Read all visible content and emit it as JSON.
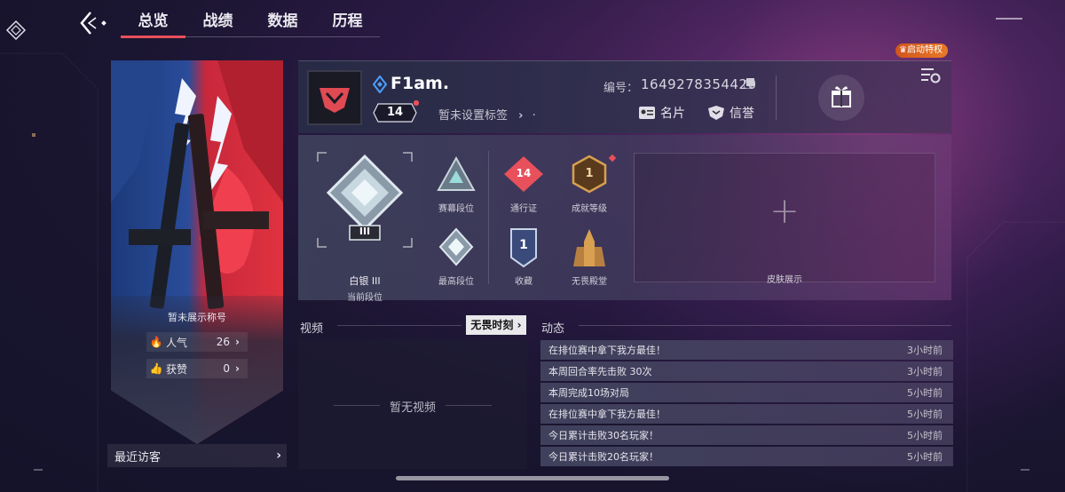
{
  "nav": {
    "tabs": [
      {
        "label": "总览",
        "active": true
      },
      {
        "label": "战绩",
        "active": false
      },
      {
        "label": "数据",
        "active": false
      },
      {
        "label": "历程",
        "active": false
      }
    ]
  },
  "privilege_badge": "启动特权",
  "profile": {
    "name": "F1am.",
    "level": "14",
    "tag_placeholder": "暂未设置标签",
    "uid_label": "编号：",
    "uid_value": "1649278354420",
    "card_label": "名片",
    "credit_label": "信誉"
  },
  "banner": {
    "title": "暂未展示称号",
    "popularity_label": "人气",
    "popularity_value": "26",
    "likes_label": "获赞",
    "likes_value": "0"
  },
  "recent_visitors": "最近访客",
  "ranks": {
    "current_rank_name": "白银 III",
    "current_rank_label": "当前段位",
    "current_rank_numeral": "III",
    "season_rank_label": "赛幕段位",
    "highest_rank_label": "最高段位",
    "battle_pass_label": "通行证",
    "battle_pass_value": "14",
    "collection_label": "收藏",
    "collection_value": "1",
    "achievement_label": "成就等级",
    "achievement_value": "1",
    "hall_label": "无畏殿堂",
    "skin_label": "皮肤展示",
    "skin_plus": "+"
  },
  "video": {
    "title": "视频",
    "moments_button": "无畏时刻",
    "empty_text": "暂无视频"
  },
  "feed": {
    "title": "动态",
    "items": [
      {
        "text": "在排位赛中拿下我方最佳！",
        "time": "3小时前"
      },
      {
        "text": "本周回合率先击败 30次",
        "time": "3小时前"
      },
      {
        "text": "本周完成10场对局",
        "time": "5小时前"
      },
      {
        "text": "在排位赛中拿下我方最佳！",
        "time": "5小时前"
      },
      {
        "text": "今日累计击败30名玩家！",
        "time": "5小时前"
      },
      {
        "text": "今日累计击败20名玩家！",
        "time": "5小时前"
      }
    ]
  },
  "colors": {
    "accent_red": "#e8505b",
    "privilege_orange": "#e87a28",
    "silver": "#c8d8e0",
    "gold": "#d8a050"
  }
}
